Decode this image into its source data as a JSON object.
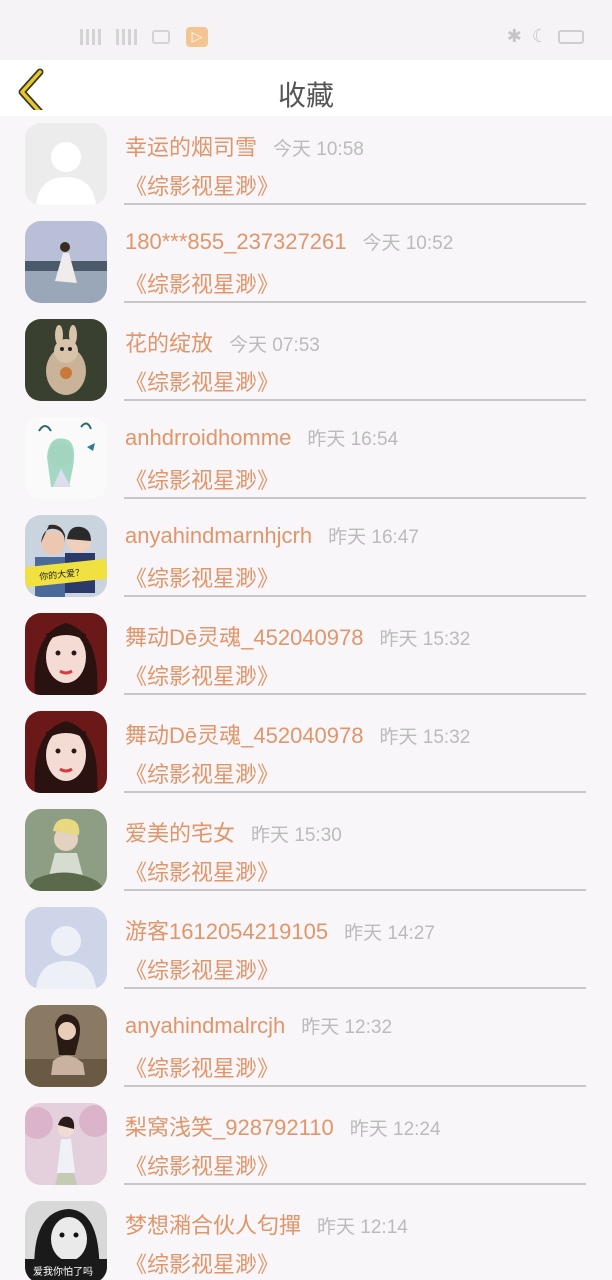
{
  "status": {
    "notif_glyph": "▷"
  },
  "header": {
    "title": "收藏"
  },
  "items": [
    {
      "name": "幸运的烟司雪",
      "time": "今天 10:58",
      "subtitle": "《综影视星渺》",
      "avatar": "default-gray"
    },
    {
      "name": "180***855_237327261",
      "time": "今天 10:52",
      "subtitle": "《综影视星渺》",
      "avatar": "seaside"
    },
    {
      "name": "花的绽放",
      "time": "今天 07:53",
      "subtitle": "《综影视星渺》",
      "avatar": "squirrel"
    },
    {
      "name": "anhdrroidhomme",
      "time": "昨天 16:54",
      "subtitle": "《综影视星渺》",
      "avatar": "anime-girl"
    },
    {
      "name": "anyahindmarnhjcrh",
      "time": "昨天 16:47",
      "subtitle": "《综影视星渺》",
      "avatar": "couple"
    },
    {
      "name": "舞动Dē灵魂_452040978",
      "time": "昨天 15:32",
      "subtitle": "《综影视星渺》",
      "avatar": "portrait-red"
    },
    {
      "name": "舞动Dē灵魂_452040978",
      "time": "昨天 15:32",
      "subtitle": "《综影视星渺》",
      "avatar": "portrait-red"
    },
    {
      "name": "爱美的宅女",
      "time": "昨天 15:30",
      "subtitle": "《综影视星渺》",
      "avatar": "girl-green"
    },
    {
      "name": "游客1612054219105",
      "time": "昨天 14:27",
      "subtitle": "《综影视星渺》",
      "avatar": "default-blue"
    },
    {
      "name": "anyahindmalrcjh",
      "time": "昨天 12:32",
      "subtitle": "《综影视星渺》",
      "avatar": "sitting-girl"
    },
    {
      "name": "梨窝浅笑_928792110",
      "time": "昨天 12:24",
      "subtitle": "《综影视星渺》",
      "avatar": "pink-trees"
    },
    {
      "name": "梦想潲合伙人匂撣",
      "time": "昨天 12:14",
      "subtitle": "《综影视星渺》",
      "avatar": "bw-girl"
    }
  ],
  "avatar_overlay_texts": {
    "couple": "你的大爱？",
    "bw-girl": "爱我你怕了吗"
  }
}
